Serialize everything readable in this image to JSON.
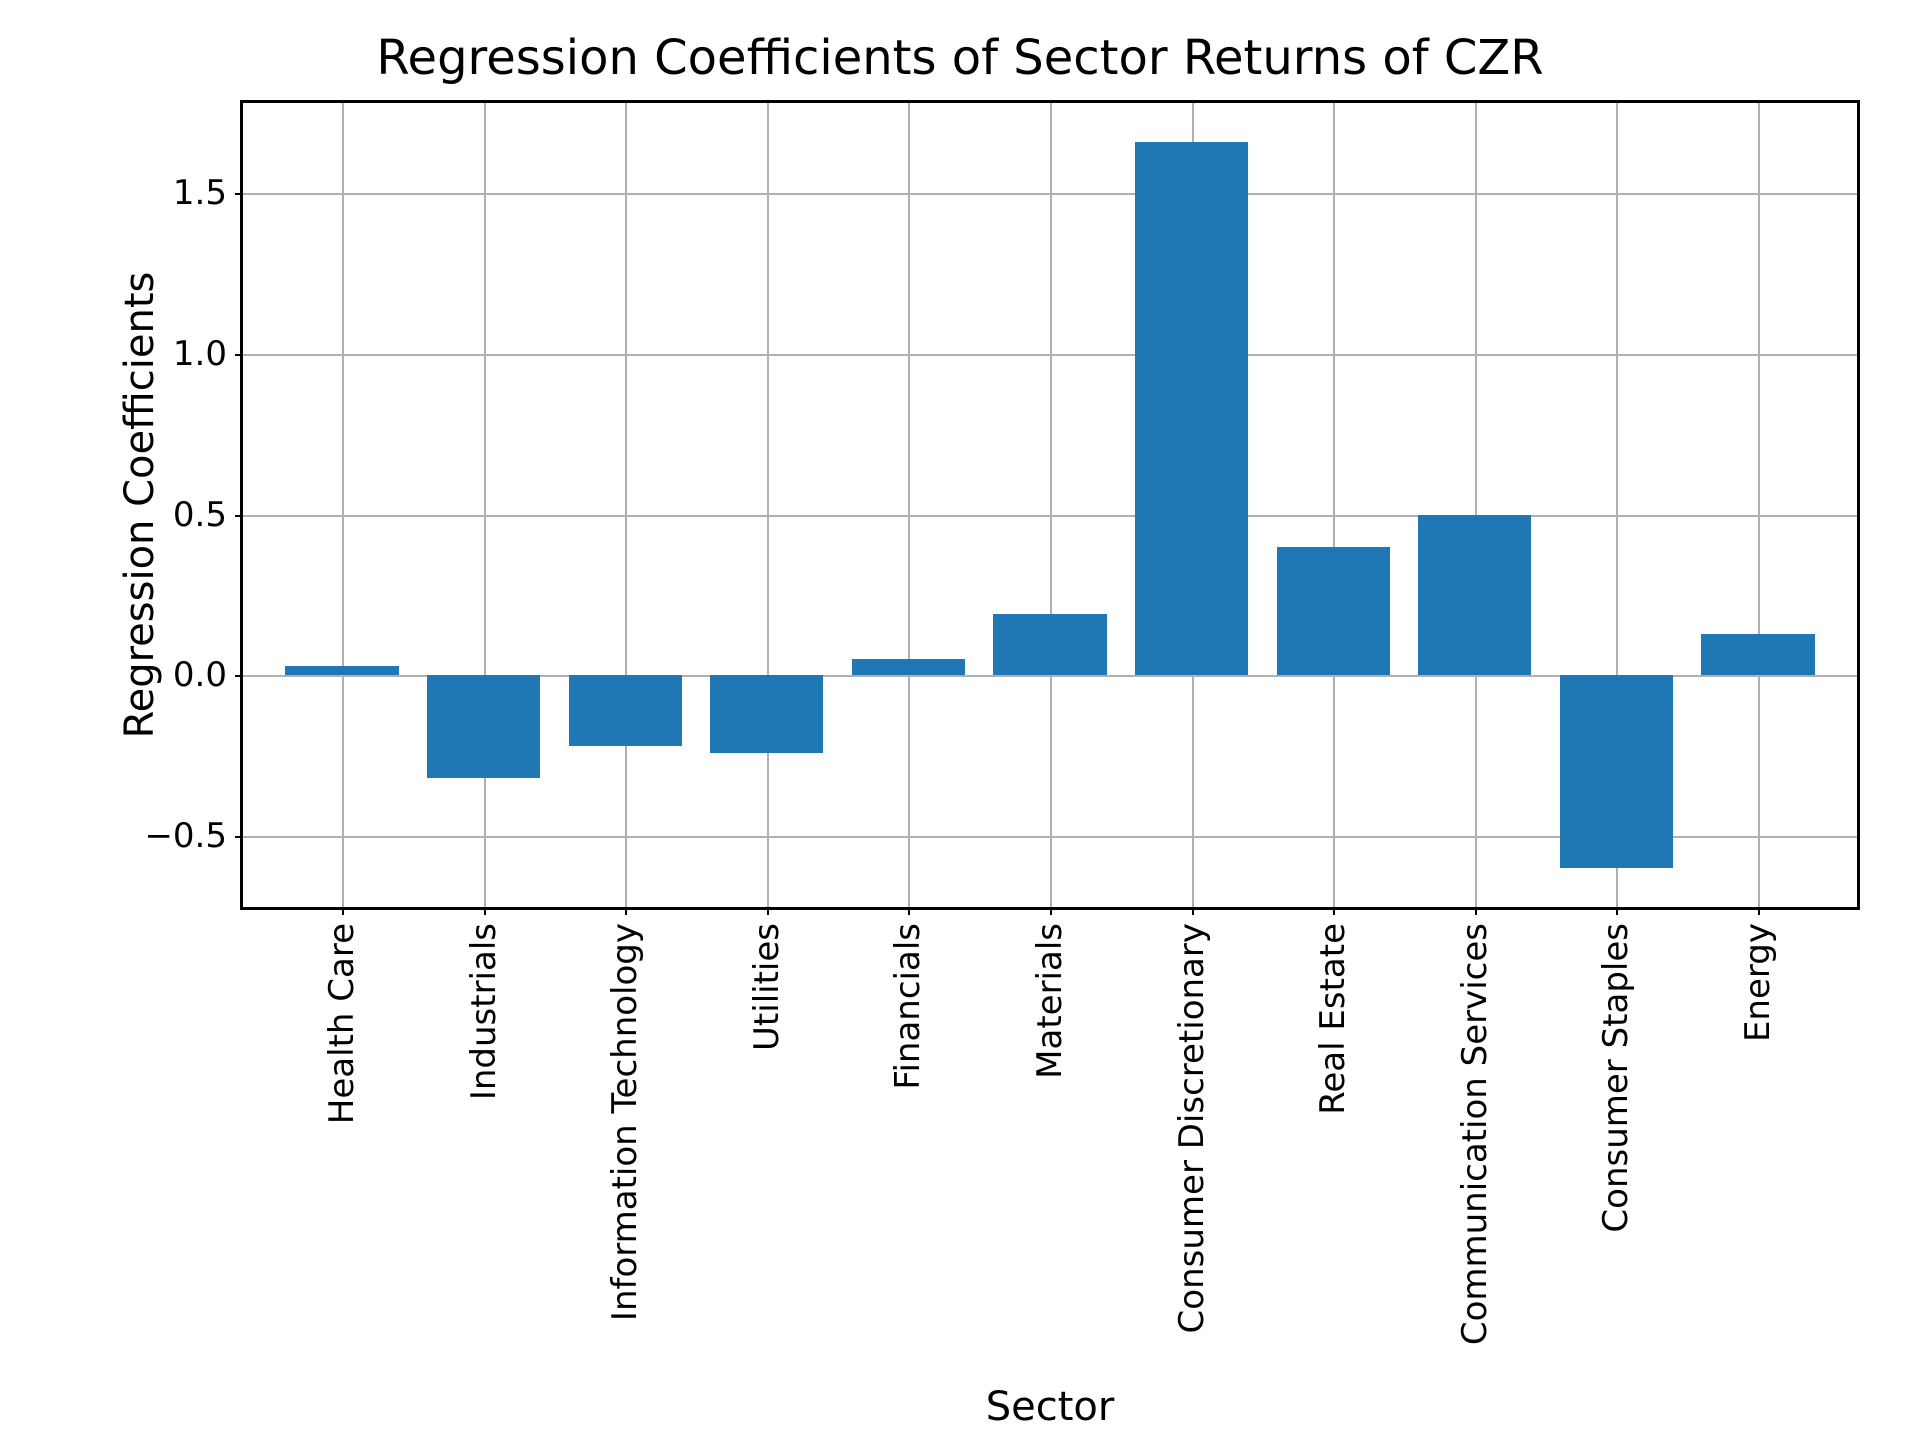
{
  "chart_data": {
    "type": "bar",
    "title": "Regression Coefficients of Sector Returns of CZR",
    "xlabel": "Sector",
    "ylabel": "Regression Coefficients",
    "categories": [
      "Health Care",
      "Industrials",
      "Information Technology",
      "Utilities",
      "Financials",
      "Materials",
      "Consumer Discretionary",
      "Real Estate",
      "Communication Services",
      "Consumer Staples",
      "Energy"
    ],
    "values": [
      0.03,
      -0.32,
      -0.22,
      -0.24,
      0.05,
      0.19,
      1.66,
      0.4,
      0.5,
      -0.6,
      0.13
    ],
    "ylim": [
      -0.72,
      1.78
    ],
    "yticks": [
      -0.5,
      0.0,
      0.5,
      1.0,
      1.5
    ],
    "ytick_labels": [
      "−0.5",
      "0.0",
      "0.5",
      "1.0",
      "1.5"
    ],
    "bar_color": "#1f77b4",
    "grid": true
  }
}
